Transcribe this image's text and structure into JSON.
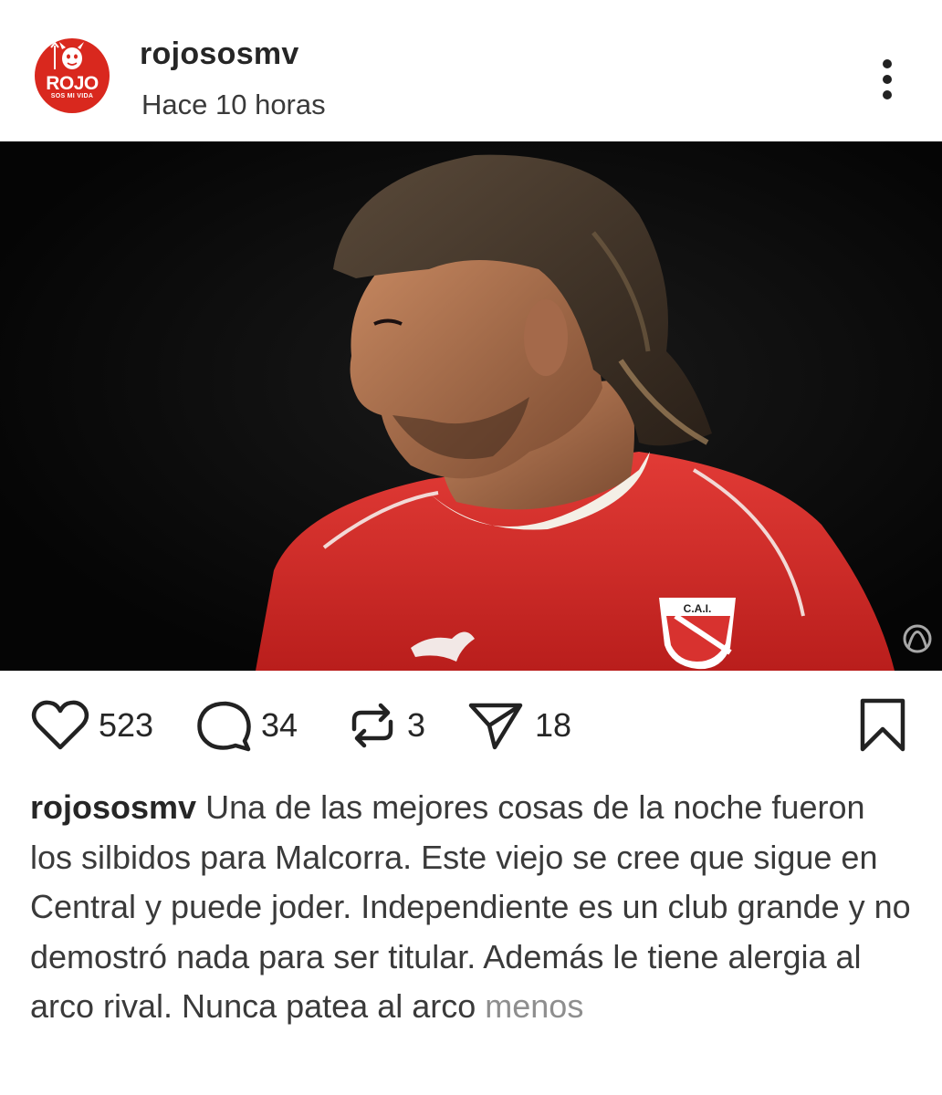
{
  "post": {
    "username": "rojososmv",
    "timestamp": "Hace 10 horas",
    "avatar": {
      "title": "ROJO",
      "subtitle": "SOS MI VIDA",
      "bg_color": "#d9281e"
    },
    "image": {
      "jersey_badge": "C.A.I.",
      "jersey_color": "#d8322f",
      "background_color": "#050505"
    }
  },
  "actions": {
    "likes": "523",
    "comments": "34",
    "reposts": "3",
    "shares": "18",
    "icons": [
      "heart-icon",
      "comment-icon",
      "repost-icon",
      "share-icon",
      "bookmark-icon"
    ]
  },
  "caption": {
    "username": "rojososmv",
    "text": "Una de las mejores cosas de la noche fueron los silbidos para Malcorra. Este viejo se cree que sigue en Central y puede joder. Independiente es un club grande y no demostró nada para ser titular. Además le tiene alergia al arco rival. Nunca patea al arco",
    "more_label": "menos"
  }
}
